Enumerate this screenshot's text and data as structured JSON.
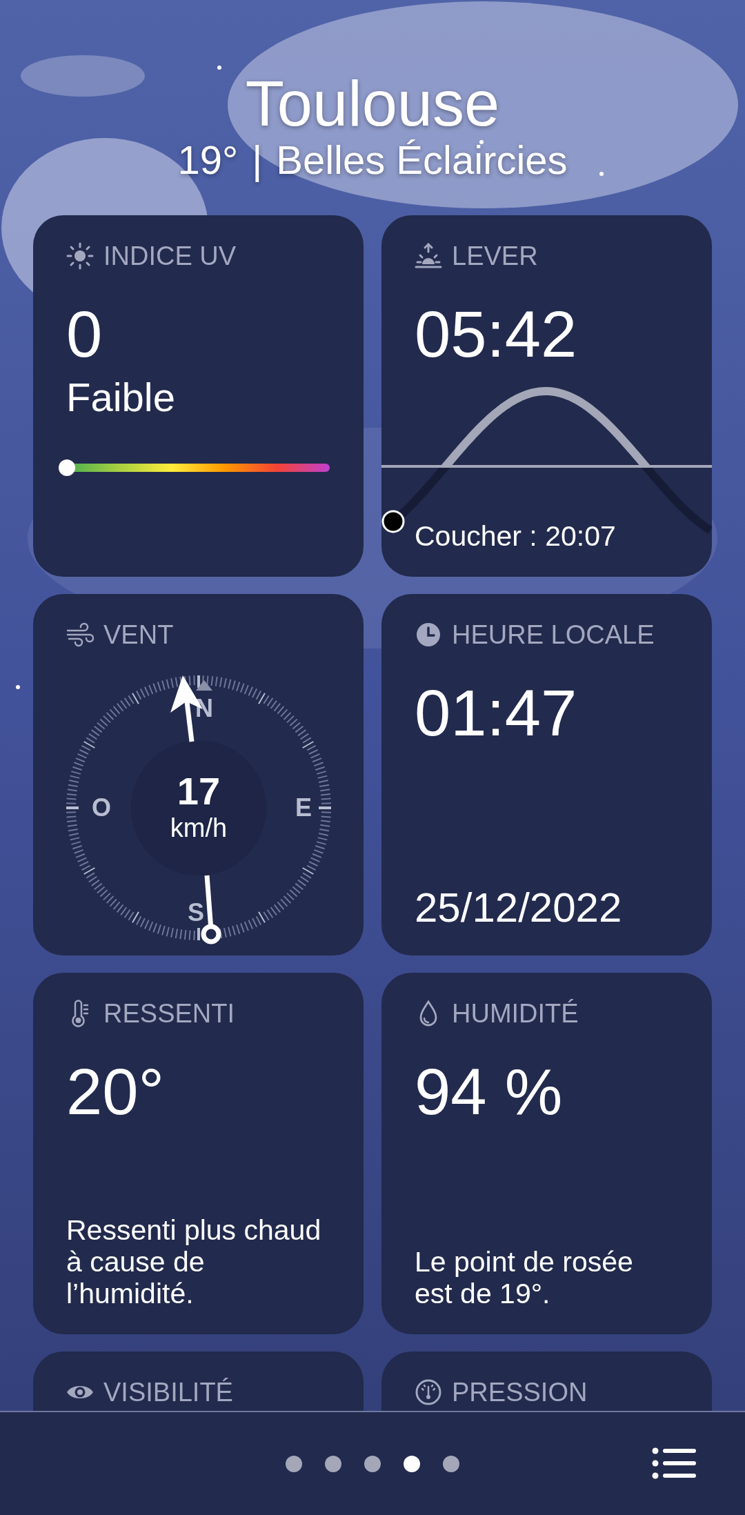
{
  "header": {
    "city": "Toulouse",
    "temperature": "19°",
    "separator": "|",
    "condition": "Belles Éclaircies"
  },
  "cards": [
    {
      "kind": "uv",
      "label": "INDICE UV",
      "value": "0",
      "description": "Faible",
      "level": 0
    },
    {
      "kind": "sun",
      "label": "LEVER",
      "value": "05:42",
      "footer": "Coucher : 20:07"
    },
    {
      "kind": "wind",
      "label": "VENT",
      "speed": "17",
      "unit": "km/h",
      "north": "N",
      "east": "E",
      "south": "S",
      "west": "O"
    },
    {
      "kind": "clock",
      "label": "HEURE LOCALE",
      "value": "01:47",
      "footer": "25/12/2022"
    },
    {
      "kind": "feels",
      "label": "RESSENTI",
      "value": "20°",
      "footer": "Ressenti plus chaud à cause de l’humidité."
    },
    {
      "kind": "humidity",
      "label": "HUMIDITÉ",
      "value": "94 %",
      "footer": "Le point de rosée est de 19°."
    },
    {
      "kind": "visibility",
      "label": "VISIBILITÉ"
    },
    {
      "kind": "pressure",
      "label": "PRESSION"
    }
  ],
  "pages": [
    {
      "selected": false
    },
    {
      "selected": false
    },
    {
      "selected": false
    },
    {
      "selected": true
    },
    {
      "selected": false
    }
  ]
}
